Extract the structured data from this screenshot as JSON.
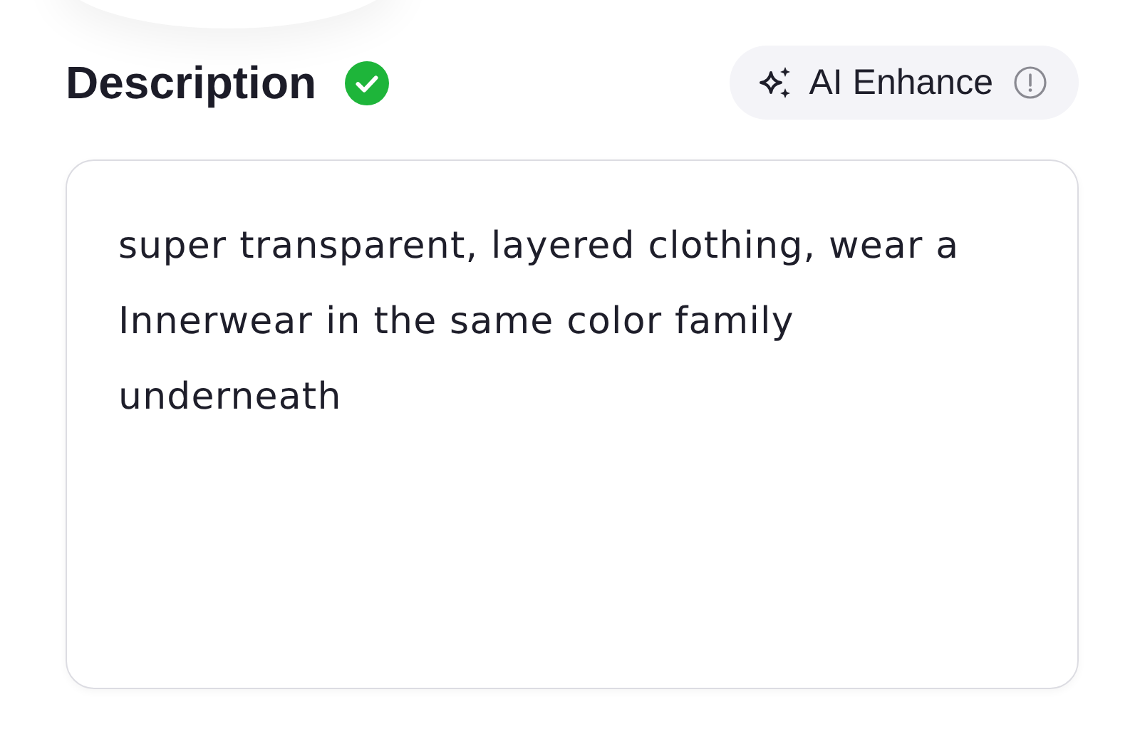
{
  "field": {
    "label": "Description",
    "valid": true,
    "value": "super transparent, layered clothing, wear a Innerwear in the same color family underneath"
  },
  "enhance_button": {
    "label": "AI Enhance"
  }
}
